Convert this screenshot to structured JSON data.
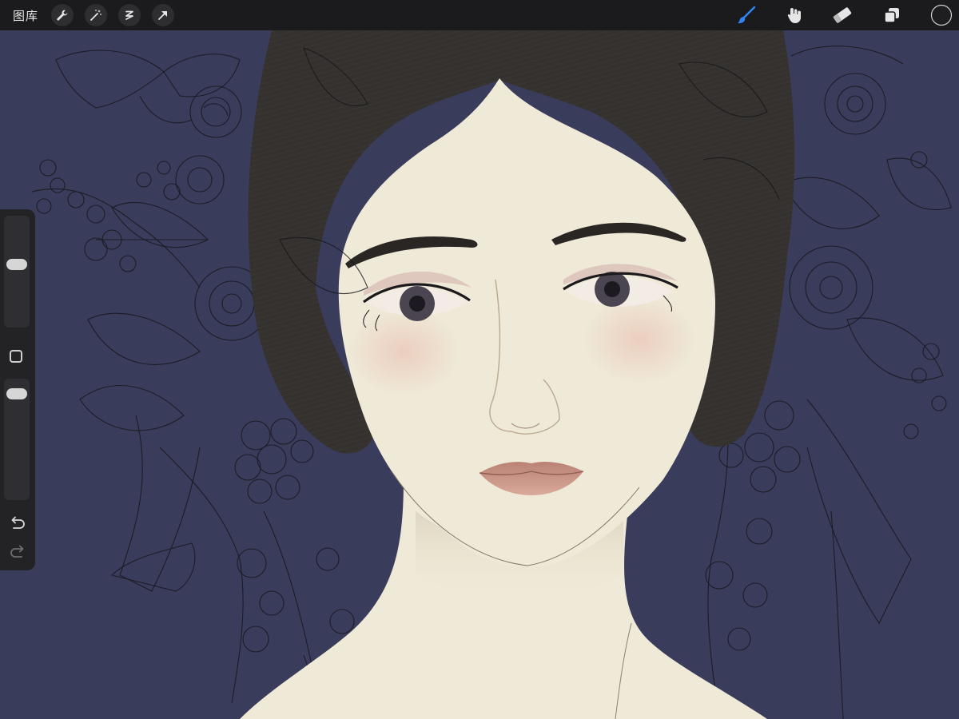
{
  "toolbar": {
    "gallery_label": "图库",
    "left_tools": [
      "wrench-icon",
      "magic-wand-icon",
      "selection-s-icon",
      "transform-arrow-icon"
    ],
    "right_tools": [
      "brush-icon",
      "smudge-icon",
      "eraser-icon",
      "layers-icon",
      "color-circle-icon"
    ],
    "active_tool": "brush-icon",
    "accent_color": "#2e86f5"
  },
  "sidebar": {
    "brush_size_level": 0.58,
    "opacity_level": 0.06,
    "modify_button": "square-icon",
    "undo": "undo-icon",
    "redo": "redo-icon"
  },
  "canvas": {
    "background_color": "#3a3c5c",
    "skin_color": "#efe9d7",
    "hair_color": "#33302d",
    "current_color": "#1e1e20"
  }
}
